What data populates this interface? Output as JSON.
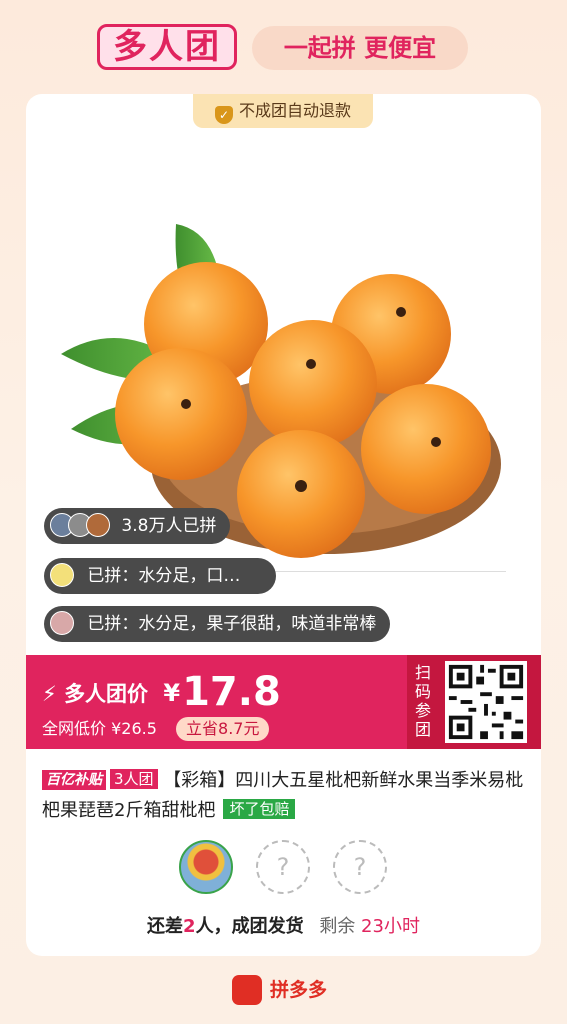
{
  "header": {
    "badge": "多人团",
    "slogan": "一起拼 更便宜"
  },
  "refund_notice": "不成团自动退款",
  "bubbles": [
    {
      "text": "3.8万人已拼"
    },
    {
      "text": "已拼：水分足，口…"
    },
    {
      "text": "已拼：水分足，果子很甜，味道非常棒"
    }
  ],
  "price": {
    "label": "多人团价",
    "currency": "¥",
    "value": "17.8",
    "market_label": "全网低价",
    "market_price": "¥26.5",
    "save": "立省8.7元"
  },
  "scan_label": "扫码参团",
  "product": {
    "tag_subsidy": "百亿补贴",
    "tag_group": "3人团",
    "title": "【彩箱】四川大五星枇杷新鲜水果当季米易枇杷果琵琶2斤箱甜枇杷",
    "tag_guarantee": "坏了包赔"
  },
  "members": {
    "placeholder": "?"
  },
  "status": {
    "prefix": "还差",
    "count": "2",
    "suffix": "人，成团发货",
    "remain_label": "剩余",
    "remain_time": "23小时"
  },
  "footer": {
    "brand": "拼多多"
  },
  "colors": {
    "accent": "#e0245e",
    "green": "#2aa845"
  }
}
